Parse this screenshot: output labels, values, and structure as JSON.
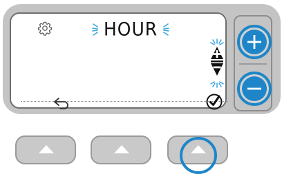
{
  "display": {
    "mode_text": "HOUR",
    "icons": {
      "settings": "gear-icon",
      "up": "up-arrow-icon",
      "down": "down-arrow-icon",
      "back": "back-arrow-icon",
      "confirm": "checkmark-icon"
    }
  },
  "side_buttons": {
    "plus_icon": "plus-icon",
    "minus_icon": "minus-icon"
  },
  "soft_buttons": [
    {
      "icon": "up-triangle-icon"
    },
    {
      "icon": "up-triangle-icon"
    },
    {
      "icon": "up-triangle-icon"
    }
  ],
  "colors": {
    "highlight": "#1e86c8",
    "bezel": "#c4c4c4",
    "screen": "#ffffff"
  }
}
